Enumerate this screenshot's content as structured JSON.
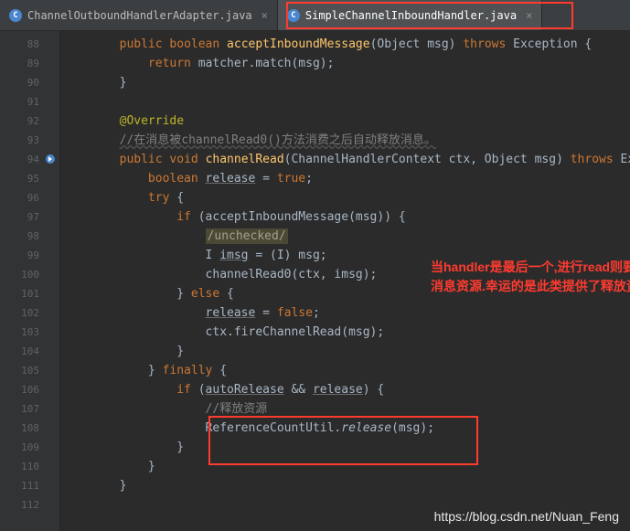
{
  "tabs": [
    {
      "icon": "C",
      "label": "ChannelOutboundHandlerAdapter.java"
    },
    {
      "icon": "C",
      "label": "SimpleChannelInboundHandler.java"
    }
  ],
  "gutter": {
    "start": 88,
    "end": 112
  },
  "code": {
    "l88": {
      "indent": "        ",
      "kw1": "public",
      "kw2": "boolean",
      "name": "acceptInboundMessage",
      "params": "(Object msg)",
      "kw3": "throws",
      "exc": "Exception {"
    },
    "l89": {
      "indent": "            ",
      "kw": "return",
      "rest": " matcher.match(msg);"
    },
    "l90": "        }",
    "l91": "",
    "l92": {
      "indent": "        ",
      "ann": "@Override"
    },
    "l93": {
      "indent": "        ",
      "comment": "//在消息被channelRead0()方法消费之后自动释放消息。"
    },
    "l94": {
      "indent": "        ",
      "kw1": "public",
      "kw2": "void",
      "name": "channelRead",
      "params": "(ChannelHandlerContext ctx, Object msg)",
      "kw3": "throws",
      "exc": "Exc"
    },
    "l95": {
      "indent": "            ",
      "kw": "boolean",
      "var": "release",
      "rest": " = ",
      "kw2": "true",
      "semi": ";"
    },
    "l96": {
      "indent": "            ",
      "kw": "try",
      "brace": " {"
    },
    "l97": {
      "indent": "                ",
      "kw": "if",
      "rest": " (acceptInboundMessage(msg)) {"
    },
    "l98": {
      "indent": "                    ",
      "box": "/unchecked/"
    },
    "l99": {
      "indent": "                    ",
      "t1": "I ",
      "var": "imsg",
      "eq": " = (",
      "t2": "I",
      "rest": ") msg;"
    },
    "l100": {
      "indent": "                    ",
      "call": "channelRead0(ctx, imsg);"
    },
    "l101": {
      "indent": "                ",
      "brace": "} ",
      "kw": "else",
      "brace2": " {"
    },
    "l102": {
      "indent": "                    ",
      "var": "release",
      "rest": " = ",
      "kw": "false",
      "semi": ";"
    },
    "l103": {
      "indent": "                    ",
      "call": "ctx.fireChannelRead(msg);"
    },
    "l104": "                }",
    "l105": {
      "indent": "            ",
      "brace": "} ",
      "kw": "finally",
      "brace2": " {"
    },
    "l106": {
      "indent": "                ",
      "kw": "if",
      "rest1": " (",
      "var1": "autoRelease",
      "amp": " && ",
      "var2": "release",
      "rest2": ") {"
    },
    "l107": {
      "indent": "                    ",
      "comment": "//释放资源"
    },
    "l108": {
      "indent": "                    ",
      "cls": "ReferenceCountUtil.",
      "method": "release",
      "rest": "(msg);"
    },
    "l109": "                }",
    "l110": "            }",
    "l111": "        }",
    "l112": ""
  },
  "callout": "当handler是最后一个,进行read则要释放消息资源.幸运的是此类提供了释放资源.",
  "watermark": "https://blog.csdn.net/Nuan_Feng"
}
